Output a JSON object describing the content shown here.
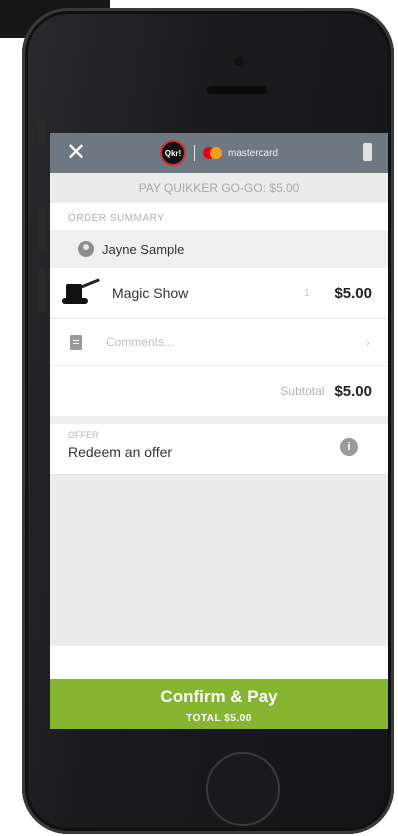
{
  "header": {
    "close_icon": "close-icon",
    "brand_logo": "Qkr!",
    "partner_logo": "mastercard",
    "device_icon": "phone-icon"
  },
  "banner": {
    "text": "PAY QUIKKER GO-GO: $5.00"
  },
  "order_summary": {
    "heading": "ORDER SUMMARY",
    "user": {
      "avatar_icon": "user-avatar-icon",
      "name": "Jayne Sample"
    },
    "items": [
      {
        "icon": "magic-hat-icon",
        "name": "Magic Show",
        "quantity": "1",
        "price": "$5.00"
      }
    ],
    "comments": {
      "icon": "document-icon",
      "placeholder": "Comments...",
      "chevron": "›"
    },
    "subtotal": {
      "label": "Subtotal",
      "value": "$5.00"
    }
  },
  "offer": {
    "label": "OFFER",
    "text": "Redeem an offer",
    "info_icon": "i"
  },
  "confirm": {
    "label": "Confirm & Pay",
    "total": "TOTAL $5.00"
  },
  "colors": {
    "topbar": "#6e7882",
    "accent_green": "#86b532",
    "mastercard_red": "#eb001b",
    "mastercard_yellow": "#f79e1b"
  }
}
